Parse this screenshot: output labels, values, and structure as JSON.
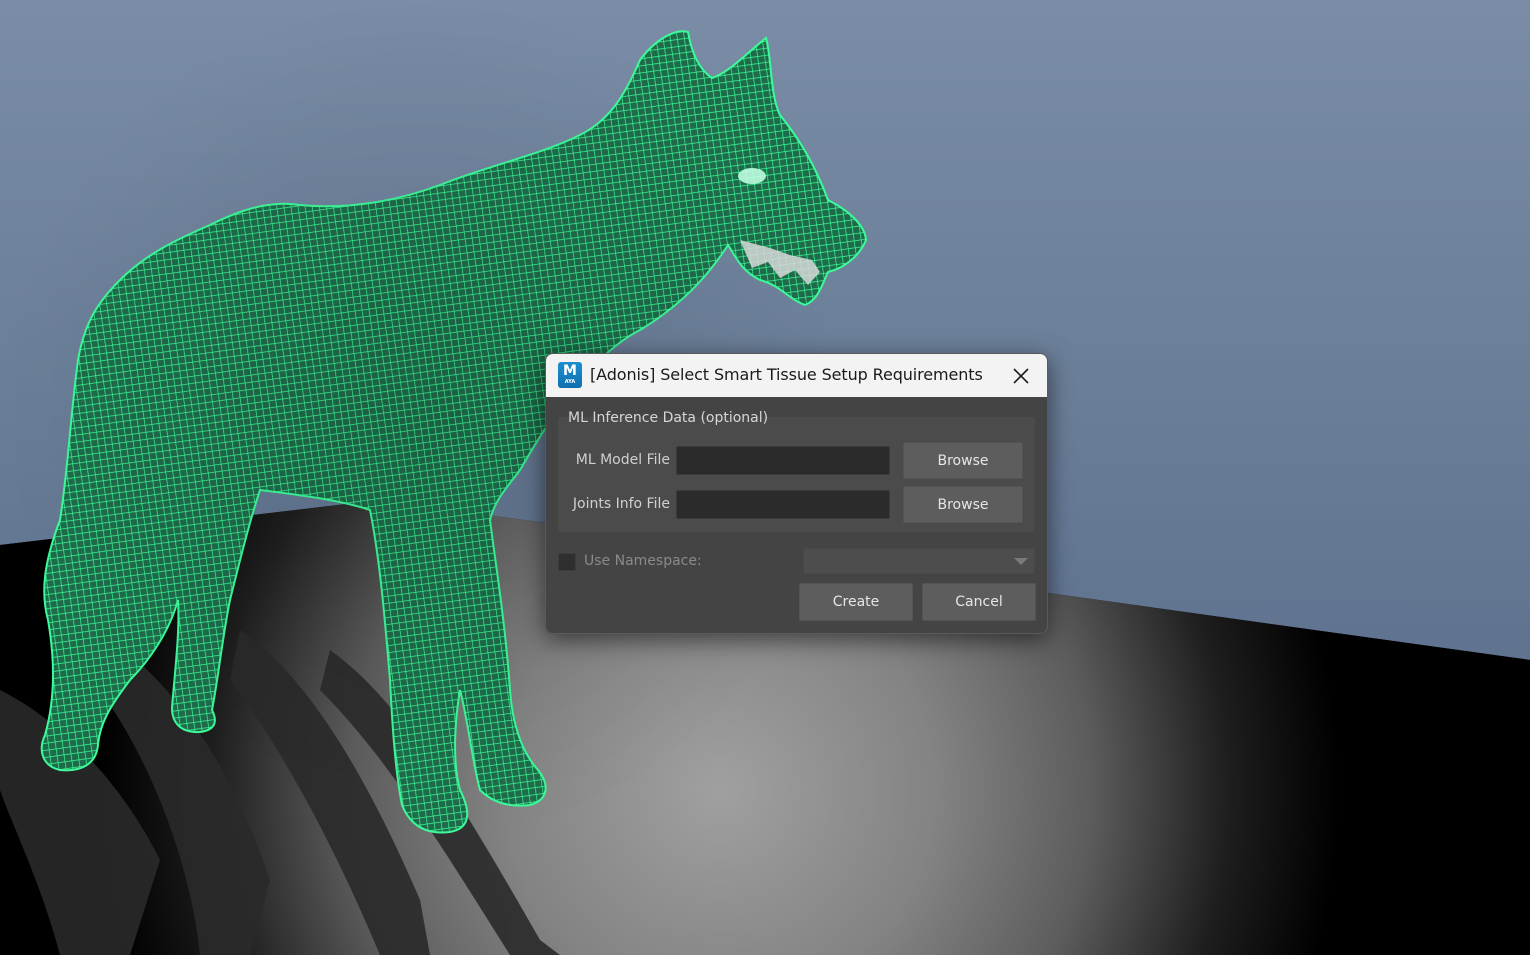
{
  "scene": {
    "description_colors": {
      "sky_top": "#7a8ca6",
      "sky_bottom": "#566b88",
      "floor": "#000000",
      "mesh": "#33f291"
    }
  },
  "dialog": {
    "app_icon": {
      "letter": "M",
      "sub": "AYA",
      "icon": "maya-app-icon"
    },
    "title": "[Adonis] Select Smart Tissue Setup Requirements",
    "close_icon": "close-icon",
    "group": {
      "title": "ML Inference Data (optional)",
      "ml_model_file": {
        "label": "ML Model File",
        "value": "",
        "browse_label": "Browse"
      },
      "joints_info_file": {
        "label": "Joints Info File",
        "value": "",
        "browse_label": "Browse"
      }
    },
    "namespace": {
      "label": "Use Namespace:",
      "checked": false,
      "selected": ""
    },
    "create_label": "Create",
    "cancel_label": "Cancel"
  }
}
